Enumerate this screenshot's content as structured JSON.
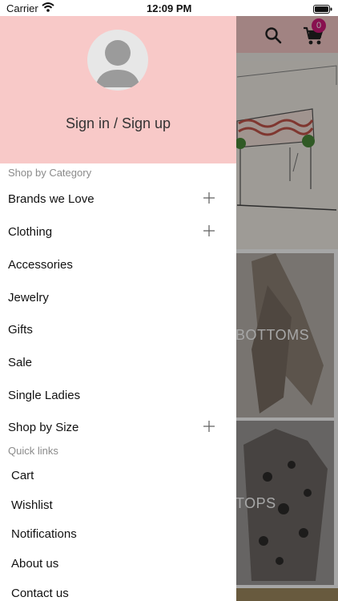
{
  "status_bar": {
    "carrier": "Carrier",
    "time": "12:09 PM"
  },
  "app_behind": {
    "cart_count": "0",
    "tiles": [
      {
        "label": "BOTTOMS"
      },
      {
        "label": "TOPS"
      }
    ],
    "colors": {
      "header_pink": "#f8c9c8",
      "badge": "#d2197a"
    }
  },
  "drawer": {
    "sign_in_label": "Sign in / Sign up",
    "category_section_title": "Shop by Category",
    "category_items": [
      {
        "label": "Brands we Love",
        "expandable": true
      },
      {
        "label": "Clothing",
        "expandable": true
      },
      {
        "label": "Accessories",
        "expandable": false
      },
      {
        "label": "Jewelry",
        "expandable": false
      },
      {
        "label": "Gifts",
        "expandable": false
      },
      {
        "label": "Sale",
        "expandable": false
      },
      {
        "label": "Single Ladies",
        "expandable": false
      },
      {
        "label": "Shop by Size",
        "expandable": true
      }
    ],
    "quick_links_title": "Quick links",
    "quick_links": [
      {
        "label": "Cart"
      },
      {
        "label": "Wishlist"
      },
      {
        "label": "Notifications"
      },
      {
        "label": "About us"
      },
      {
        "label": "Contact us"
      }
    ]
  }
}
